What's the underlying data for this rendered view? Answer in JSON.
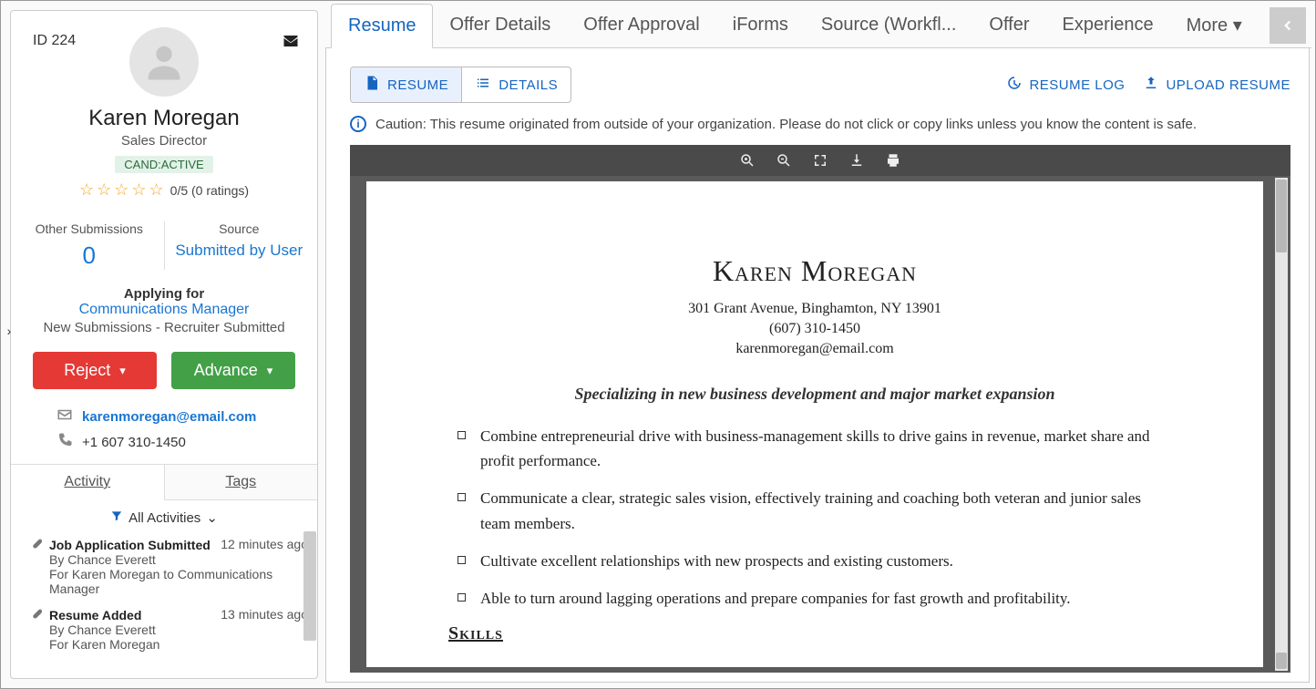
{
  "candidate": {
    "id_label": "ID 224",
    "name": "Karen Moregan",
    "title": "Sales Director",
    "badge": "CAND:ACTIVE",
    "rating_text": "0/5 (0 ratings)",
    "other_submissions_label": "Other Submissions",
    "other_submissions_value": "0",
    "source_label": "Source",
    "source_value": "Submitted by User",
    "applying_label": "Applying for",
    "applying_link": "Communications Manager",
    "applying_note": "New Submissions - Recruiter Submitted",
    "reject_label": "Reject",
    "advance_label": "Advance",
    "email": "karenmoregan@email.com",
    "phone": "+1 607 310-1450"
  },
  "small_tabs": {
    "activity": "Activity",
    "tags": "Tags"
  },
  "activities_filter": "All Activities",
  "activities": [
    {
      "title": "Job Application Submitted",
      "ts": "12 minutes ago",
      "by": "By Chance Everett",
      "detail": "For Karen Moregan to Communications Manager"
    },
    {
      "title": "Resume Added",
      "ts": "13 minutes ago",
      "by": "By Chance Everett",
      "detail": "For Karen Moregan"
    }
  ],
  "tabs": [
    "Resume",
    "Offer Details",
    "Offer Approval",
    "iForms",
    "Source (Workfl...",
    "Offer",
    "Experience",
    "More"
  ],
  "subtabs": {
    "resume": "RESUME",
    "details": "DETAILS"
  },
  "actions": {
    "log": "RESUME LOG",
    "upload": "UPLOAD RESUME"
  },
  "caution": "Caution: This resume originated from outside of your organization. Please do not click or copy links unless you know the content is safe.",
  "resume": {
    "name": "Karen Moregan",
    "address": "301 Grant Avenue, Binghamton, NY 13901",
    "phone": "(607) 310-1450",
    "email": "karenmoregan@email.com",
    "tagline": "Specializing in new business development and major market expansion",
    "bullets": [
      "Combine entrepreneurial drive with business-management skills to drive gains in revenue, market share and profit performance.",
      "Communicate a clear, strategic sales vision, effectively training and coaching both veteran and junior sales team members.",
      "Cultivate excellent relationships with new prospects and existing customers.",
      "Able to turn around lagging operations and prepare companies for fast growth and profitability."
    ],
    "skills_heading": "Skills"
  }
}
